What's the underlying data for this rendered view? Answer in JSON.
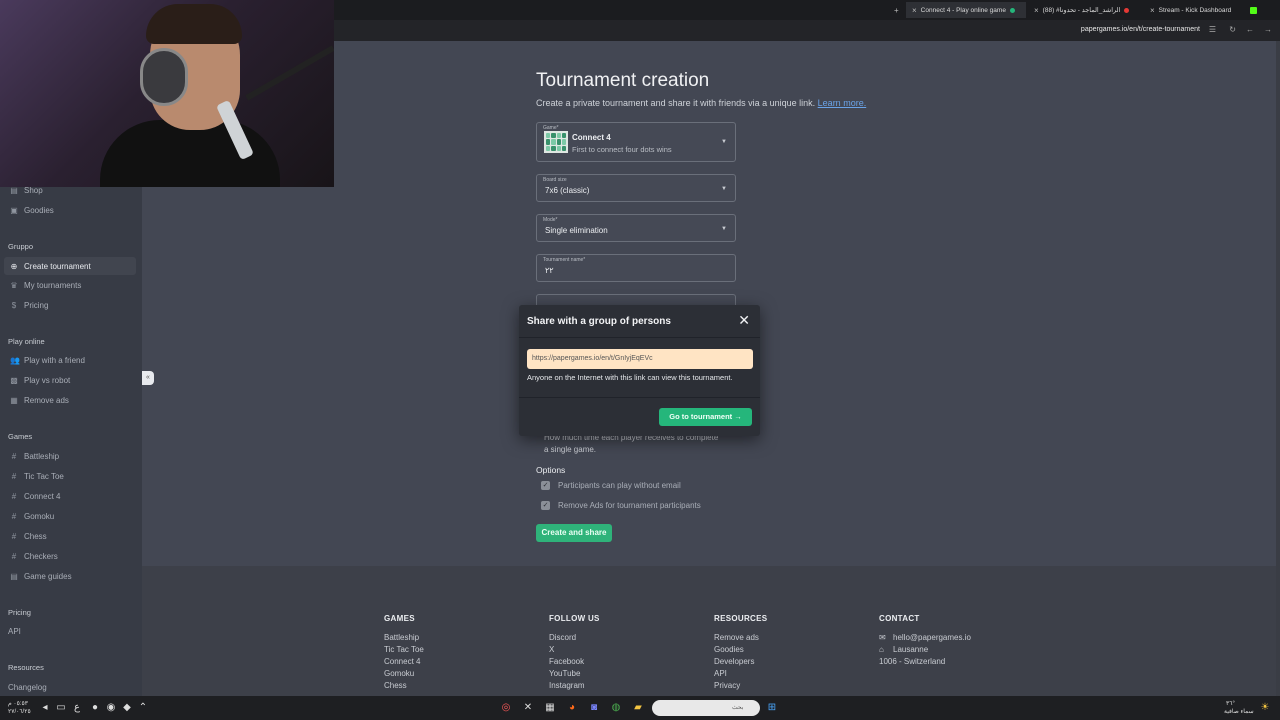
{
  "browser": {
    "tabs": [
      {
        "label": "Connect 4 - Play online game",
        "active": true
      },
      {
        "label": "(88) #الراشد_الماجد - تحدونا"
      },
      {
        "label": "Stream - Kick Dashboard"
      }
    ],
    "url": "papergames.io/en/t/create-tournament"
  },
  "sidebar": {
    "top_items": [
      {
        "label": "Shop",
        "icon": "shop-icon"
      },
      {
        "label": "Goodies",
        "icon": "gift-icon"
      }
    ],
    "group_heading": "Gruppo",
    "group_items": [
      {
        "label": "Create tournament",
        "icon": "plus-circle-icon",
        "active": true
      },
      {
        "label": "My tournaments",
        "icon": "trophy-icon"
      },
      {
        "label": "Pricing",
        "icon": "dollar-icon"
      }
    ],
    "play_heading": "Play online",
    "play_items": [
      {
        "label": "Play with a friend",
        "icon": "users-icon"
      },
      {
        "label": "Play vs robot",
        "icon": "robot-icon"
      },
      {
        "label": "Remove ads",
        "icon": "ads-icon"
      }
    ],
    "games_heading": "Games",
    "games_items": [
      {
        "label": "Battleship"
      },
      {
        "label": "Tic Tac Toe"
      },
      {
        "label": "Connect 4"
      },
      {
        "label": "Gomoku"
      },
      {
        "label": "Chess"
      },
      {
        "label": "Checkers"
      },
      {
        "label": "Game guides"
      }
    ],
    "pricing_heading": "Pricing",
    "api_label": "API",
    "resources_heading": "Resources",
    "changelog_label": "Changelog"
  },
  "form": {
    "title": "Tournament creation",
    "subtitle": "Create a private tournament and share it with friends via a unique link.",
    "learn_more": "Learn more.",
    "game_label": "Game*",
    "game_name": "Connect 4",
    "game_desc": "First to connect four dots wins",
    "board_label": "Board size",
    "board_value": "7x6 (classic)",
    "mode_label": "Mode*",
    "mode_value": "Single elimination",
    "name_label": "Tournament name*",
    "name_value": "٢٢",
    "time_help_line1": "How much time each player receives to complete",
    "time_help_line2": "a single game.",
    "options_heading": "Options",
    "option1": "Participants can play without email",
    "option2": "Remove Ads for tournament participants",
    "create_button": "Create and share"
  },
  "modal": {
    "title": "Share with a group of persons",
    "link": "https://papergames.io/en/t/GnIyjEqEVc",
    "note": "Anyone on the Internet with this link can view this tournament.",
    "go_button": "Go to tournament →"
  },
  "footer": {
    "games": {
      "heading": "GAMES",
      "links": [
        "Battleship",
        "Tic Tac Toe",
        "Connect 4",
        "Gomoku",
        "Chess"
      ]
    },
    "follow": {
      "heading": "FOLLOW US",
      "links": [
        "Discord",
        "X",
        "Facebook",
        "YouTube",
        "Instagram"
      ]
    },
    "resources": {
      "heading": "RESOURCES",
      "links": [
        "Remove ads",
        "Goodies",
        "Developers",
        "API",
        "Privacy"
      ]
    },
    "contact": {
      "heading": "CONTACT",
      "email": "hello@papergames.io",
      "city": "Lausanne",
      "address": "1006 - Switzerland"
    }
  },
  "taskbar": {
    "search_placeholder": "بحث",
    "time": "٠٥:٥٣ م",
    "date": "٢٧/٠٦/٢٥",
    "weather": "٣٦°",
    "weather_desc": "سماء صافية"
  },
  "colors": {
    "accent_green": "#2fb37a",
    "link_box": "#ffe4c4",
    "link_blue": "#6aa3e8"
  }
}
